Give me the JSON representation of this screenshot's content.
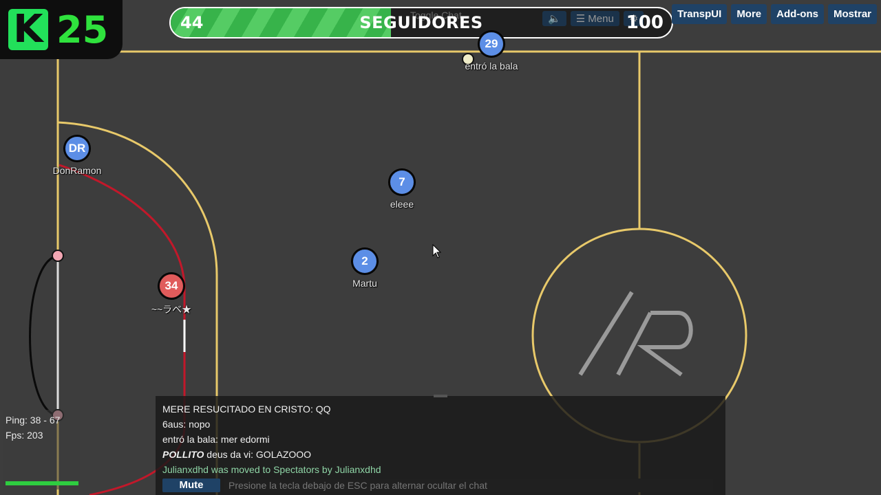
{
  "kbadge": {
    "logo": "K",
    "count": "25"
  },
  "followers": {
    "current": "44",
    "label": "SEGUIDORES",
    "goal": "100",
    "progress": 0.44,
    "overlay_toggle": "Toggle Chat",
    "overlay_sound": "🔈",
    "overlay_menu": "☰ Menu",
    "overlay_gear": "⚙"
  },
  "top_buttons": [
    "TranspUI",
    "More",
    "Add-ons",
    "Mostrar"
  ],
  "players": [
    {
      "avatar": "29",
      "name": "entró la bala",
      "team": "blue"
    },
    {
      "avatar": "DR",
      "name": "DonRamon",
      "team": "blue"
    },
    {
      "avatar": "7",
      "name": "eleee",
      "team": "blue"
    },
    {
      "avatar": "2",
      "name": "Martu",
      "team": "blue"
    },
    {
      "avatar": "34",
      "name": "~~ラベ★",
      "team": "red"
    }
  ],
  "stats": {
    "ping": "Ping: 38 - 67",
    "fps": "Fps: 203"
  },
  "chat": {
    "lines": [
      {
        "text": "MERE RESUCITADO EN CRISTO: QQ"
      },
      {
        "text": "6aus: nopo"
      },
      {
        "text": "entró la bala: mer edormi"
      },
      {
        "bold": "POLLITO",
        "text": " deus da vi: GOLAZOOO"
      },
      {
        "text": "Julianxdhd was moved to Spectators by Julianxdhd"
      }
    ],
    "mute_label": "Mute",
    "input_placeholder": "Presione la tecla debajo de ESC para alternar ocultar el chat"
  },
  "colors": {
    "field": "#3d3d3d",
    "lines": "#e8c96a",
    "red_team": "#e05b5b",
    "blue_team": "#5c8ee6",
    "goal_net": "#c2182a"
  }
}
